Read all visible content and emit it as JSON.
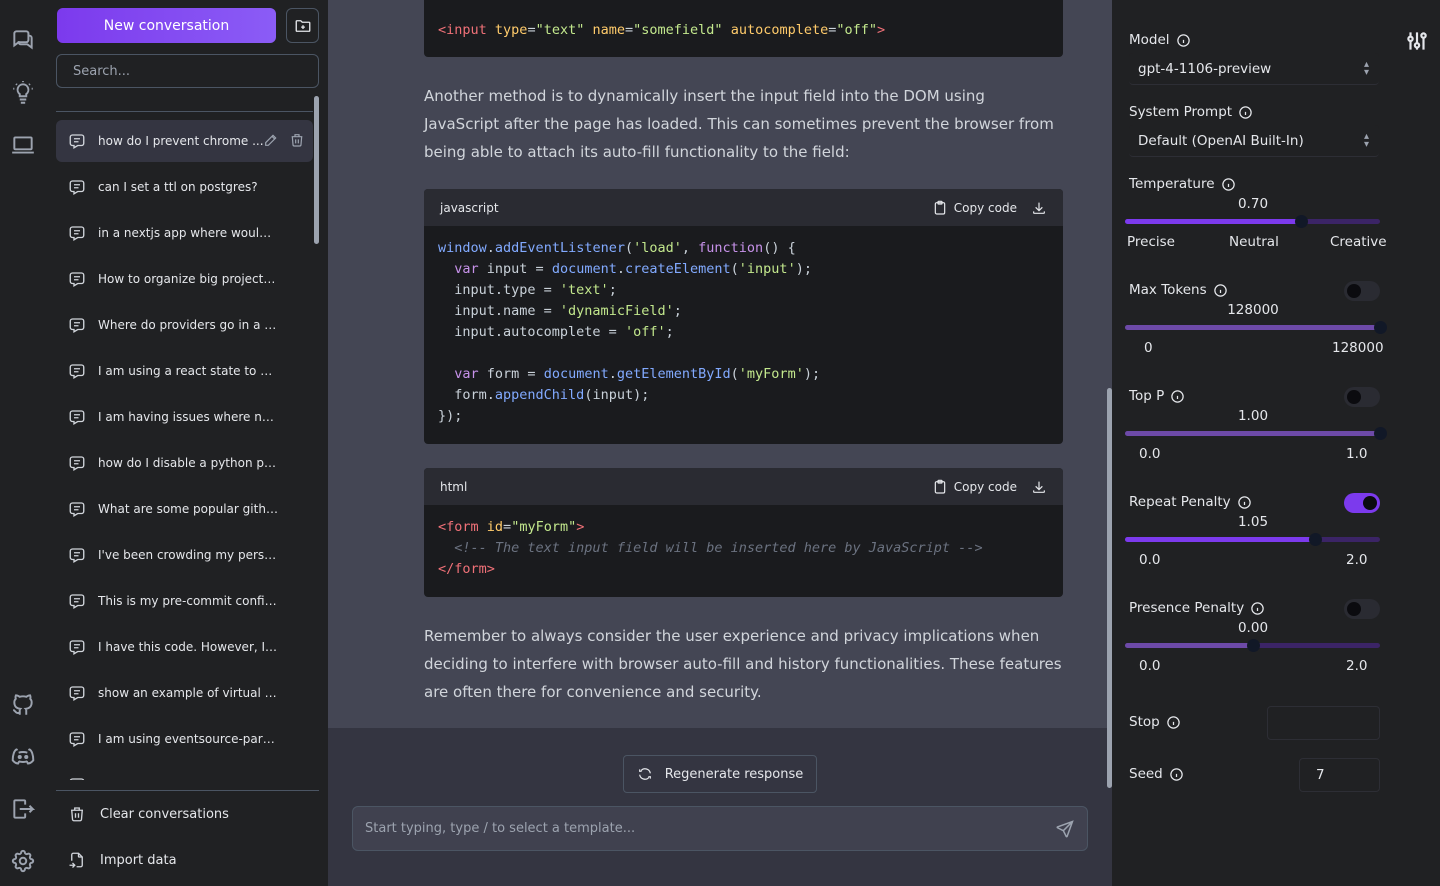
{
  "left_rail": {
    "icons": [
      "chats-icon",
      "lightbulb-icon",
      "laptop-icon",
      "github-icon",
      "discord-icon",
      "logout-icon",
      "settings-icon"
    ]
  },
  "sidebar": {
    "new_conversation_label": "New conversation",
    "search_placeholder": "Search...",
    "conversations": [
      "how do I prevent chrome ...",
      "can I set a ttl on postgres?",
      "in a nextjs app where would I ...",
      "How to organize big projects a...",
      "Where do providers go in a nex...",
      "I am using a react state to ho...",
      "I am having issues where next ...",
      "how do I disable a python pre-...",
      "What are some popular github a...",
      "I've been crowding my personal...",
      "This is my pre-commit config f...",
      "I have this code. However, I w...",
      "show an example of virtual bas...",
      "I am using eventsource-parser ...",
      "I..."
    ],
    "clear_label": "Clear conversations",
    "import_label": "Import data"
  },
  "chat": {
    "top_code": "<input type=\"text\" name=\"somefield\" autocomplete=\"off\">",
    "para1": "Another method is to dynamically insert the input field into the DOM using JavaScript after the page has loaded. This can sometimes prevent the browser from being able to attach its auto-fill functionality to the field:",
    "block_js": {
      "lang": "javascript",
      "copy_label": "Copy code"
    },
    "block_html": {
      "lang": "html",
      "copy_label": "Copy code"
    },
    "para2": "Remember to always consider the user experience and privacy implications when deciding to interfere with browser auto-fill and history functionalities. These features are often there for convenience and security.",
    "regenerate_label": "Regenerate response",
    "input_placeholder": "Start typing, type / to select a template..."
  },
  "settings": {
    "model": {
      "label": "Model",
      "value": "gpt-4-1106-preview"
    },
    "system_prompt": {
      "label": "System Prompt",
      "value": "Default (OpenAI Built-In)"
    },
    "temperature": {
      "label": "Temperature",
      "value": "0.70",
      "fraction": 0.69,
      "left": "Precise",
      "mid": "Neutral",
      "right": "Creative"
    },
    "max_tokens": {
      "label": "Max Tokens",
      "value": "128000",
      "fraction": 1.0,
      "min": "0",
      "max": "128000",
      "enabled": false
    },
    "top_p": {
      "label": "Top P",
      "value": "1.00",
      "fraction": 1.0,
      "min": "0.0",
      "max": "1.0",
      "enabled": false
    },
    "repeat_penalty": {
      "label": "Repeat Penalty",
      "value": "1.05",
      "fraction": 0.745,
      "min": "0.0",
      "max": "2.0",
      "enabled": true
    },
    "presence_penalty": {
      "label": "Presence Penalty",
      "value": "0.00",
      "fraction": 0.5,
      "min": "0.0",
      "max": "2.0",
      "enabled": false
    },
    "stop": {
      "label": "Stop",
      "value": ""
    },
    "seed": {
      "label": "Seed",
      "value": "7"
    }
  },
  "colors": {
    "accent": "#7c3aed",
    "sidebar": "#202123",
    "main": "#343541",
    "message": "#444654",
    "code": "#1a1b1e"
  }
}
